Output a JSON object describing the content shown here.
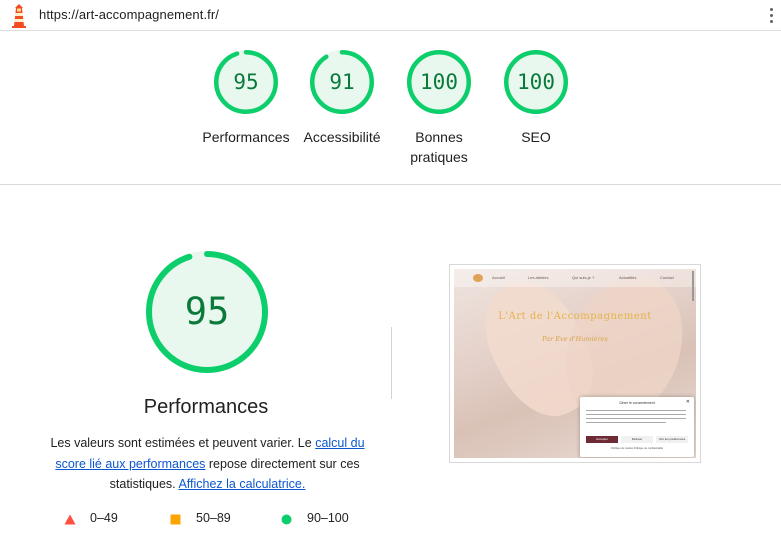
{
  "browser": {
    "url": "https://art-accompagnement.fr/"
  },
  "colors": {
    "pass": "#0cce6b",
    "pass_fill": "#e8f8ee",
    "pass_text": "#0a7a3a",
    "average": "#ffa400",
    "fail": "#ff4e42",
    "link": "#0b57d0"
  },
  "categories": [
    {
      "label": "Performances",
      "score": 95
    },
    {
      "label": "Accessibilité",
      "score": 91
    },
    {
      "label": "Bonnes pratiques",
      "score": 100
    },
    {
      "label": "SEO",
      "score": 100
    }
  ],
  "main": {
    "score": 95,
    "title": "Performances",
    "desc_part1": "Les valeurs sont estimées et peuvent varier. Le ",
    "desc_link1": "calcul du score lié aux performances",
    "desc_part2": " repose directement sur ces statistiques. ",
    "desc_link2": "Affichez la calculatrice."
  },
  "legend": [
    {
      "icon": "triangle-icon",
      "range": "0–49"
    },
    {
      "icon": "square-icon",
      "range": "50–89"
    },
    {
      "icon": "circle-icon",
      "range": "90–100"
    }
  ],
  "thumbnail": {
    "nav": [
      "Accueil",
      "Les ateliers",
      "Qui suis-je ?",
      "Actualités",
      "Contact"
    ],
    "site_title": "L'Art de l'Accompagnement",
    "site_subtitle": "Par Eve d'Humières",
    "cookie_title": "Gérer le consentement",
    "cookie_accept": "Accepter",
    "cookie_refuse": "Refuser",
    "cookie_prefs": "Voir les préférences",
    "cookie_links": "Politique de cookies   Politique de confidentialité"
  }
}
